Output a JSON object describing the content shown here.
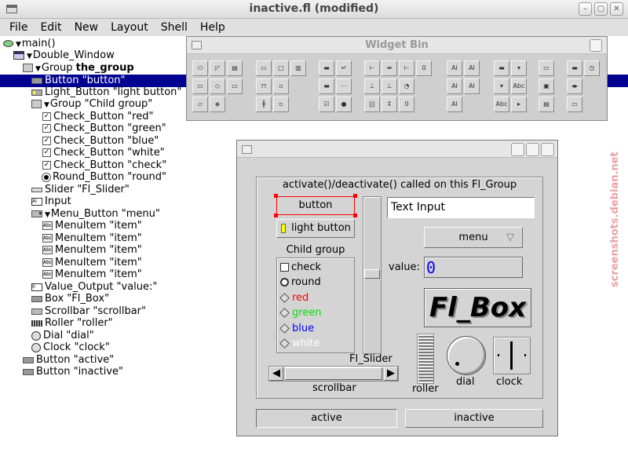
{
  "window": {
    "title": "inactive.fl (modified)"
  },
  "menubar": {
    "items": [
      {
        "label": "File"
      },
      {
        "label": "Edit"
      },
      {
        "label": "New"
      },
      {
        "label": "Layout"
      },
      {
        "label": "Shell"
      },
      {
        "label": "Help"
      }
    ]
  },
  "tree": [
    {
      "label": "main()"
    },
    {
      "label": "Double_Window"
    },
    {
      "label": "Group ",
      "bold": "the_group"
    },
    {
      "label": "Button  \"button\""
    },
    {
      "label": "Light_Button  \"light button\""
    },
    {
      "label": "Group  \"Child group\""
    },
    {
      "label": "Check_Button  \"red\""
    },
    {
      "label": "Check_Button  \"green\""
    },
    {
      "label": "Check_Button  \"blue\""
    },
    {
      "label": "Check_Button  \"white\""
    },
    {
      "label": "Check_Button  \"check\""
    },
    {
      "label": "Round_Button  \"round\""
    },
    {
      "label": "Slider  \"Fl_Slider\""
    },
    {
      "label": "Input"
    },
    {
      "label": "Menu_Button  \"menu\""
    },
    {
      "label": "MenuItem  \"item\""
    },
    {
      "label": "MenuItem  \"item\""
    },
    {
      "label": "MenuItem  \"item\""
    },
    {
      "label": "MenuItem  \"item\""
    },
    {
      "label": "MenuItem  \"item\""
    },
    {
      "label": "Value_Output  \"value:\""
    },
    {
      "label": "Box  \"Fl_Box\""
    },
    {
      "label": "Scrollbar  \"scrollbar\""
    },
    {
      "label": "Roller  \"roller\""
    },
    {
      "label": "Dial  \"dial\""
    },
    {
      "label": "Clock  \"clock\""
    },
    {
      "label": "Button  \"active\""
    },
    {
      "label": "Button  \"inactive\""
    }
  ],
  "widget_bin": {
    "title": "Widget Bin"
  },
  "test_window": {
    "group_label": "activate()/deactivate() called on this Fl_Group",
    "button": "button",
    "light_button": "light button",
    "child_group": "Child group",
    "child_items": [
      {
        "label": "check",
        "color": "#000000"
      },
      {
        "label": "round",
        "color": "#000000"
      },
      {
        "label": "red",
        "color": "#ff0000"
      },
      {
        "label": "green",
        "color": "#00e000"
      },
      {
        "label": "blue",
        "color": "#0000ff"
      },
      {
        "label": "white",
        "color": "#ffffff"
      }
    ],
    "slider_label": "Fl_Slider",
    "text_input": "Text Input",
    "menu": "menu",
    "value_label": "value:",
    "value": "0",
    "box_label": "Fl_Box",
    "scrollbar_label": "scrollbar",
    "roller_label": "roller",
    "dial_label": "dial",
    "clock_label": "clock",
    "active": "active",
    "inactive": "inactive"
  },
  "watermark": "screenshots.debian.net"
}
